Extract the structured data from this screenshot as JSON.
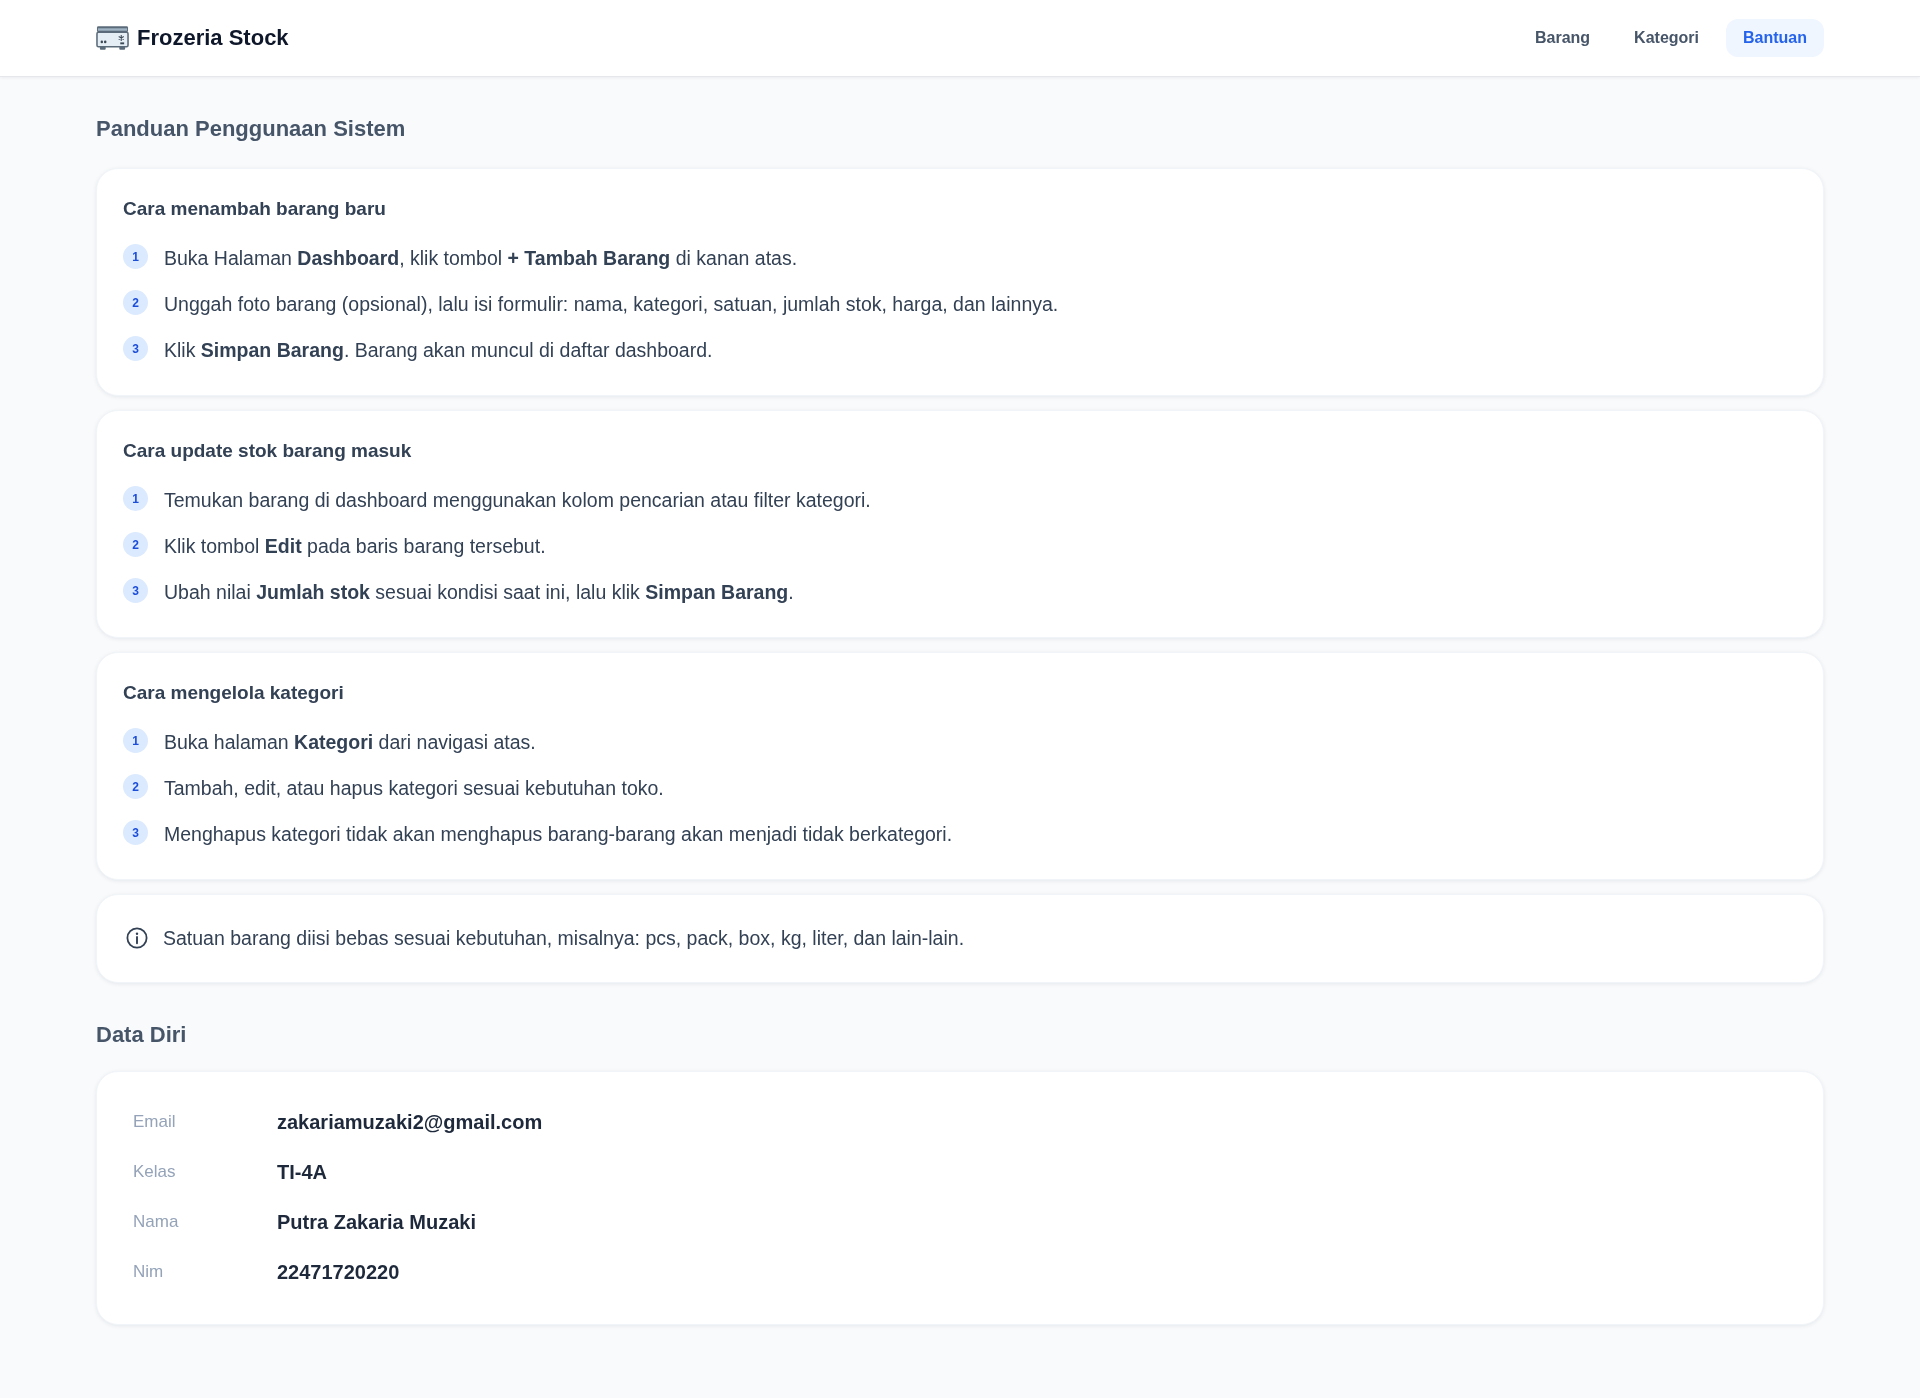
{
  "header": {
    "brand": "Frozeria Stock",
    "nav": [
      {
        "label": "Barang",
        "selected": false
      },
      {
        "label": "Kategori",
        "selected": false
      },
      {
        "label": "Bantuan",
        "selected": true
      }
    ]
  },
  "guide": {
    "title": "Panduan Penggunaan Sistem",
    "sections": [
      {
        "title": "Cara menambah barang baru",
        "steps": [
          {
            "number": "1",
            "text": "Buka Halaman **Dashboard**, klik tombol **+ Tambah Barang** di kanan atas."
          },
          {
            "number": "2",
            "text": "Unggah foto barang (opsional), lalu isi formulir: nama, kategori, satuan, jumlah stok, harga, dan lainnya."
          },
          {
            "number": "3",
            "text": "Klik **Simpan Barang**. Barang akan muncul di daftar dashboard."
          }
        ]
      },
      {
        "title": "Cara update stok barang masuk",
        "steps": [
          {
            "number": "1",
            "text": "Temukan barang di dashboard menggunakan kolom pencarian atau filter kategori."
          },
          {
            "number": "2",
            "text": "Klik tombol **Edit** pada baris barang tersebut."
          },
          {
            "number": "3",
            "text": "Ubah nilai **Jumlah stok** sesuai kondisi saat ini, lalu klik **Simpan Barang**."
          }
        ]
      },
      {
        "title": "Cara mengelola kategori",
        "steps": [
          {
            "number": "1",
            "text": "Buka halaman **Kategori** dari navigasi atas."
          },
          {
            "number": "2",
            "text": "Tambah, edit, atau hapus kategori sesuai kebutuhan toko."
          },
          {
            "number": "3",
            "text": "Menghapus kategori tidak akan menghapus barang-barang akan menjadi tidak berkategori."
          }
        ]
      }
    ],
    "note": {
      "text": "Satuan barang diisi bebas sesuai kebutuhan, misalnya: pcs, pack, box, kg, liter, dan lain-lain."
    }
  },
  "profile": {
    "title": "Data Diri",
    "fields": [
      {
        "label": "Email",
        "value": "zakariamuzaki2@gmail.com"
      },
      {
        "label": "Kelas",
        "value": "TI-4A"
      },
      {
        "label": "Nama",
        "value": "Putra Zakaria Muzaki"
      },
      {
        "label": "Nim",
        "value": "22471720220"
      }
    ]
  }
}
